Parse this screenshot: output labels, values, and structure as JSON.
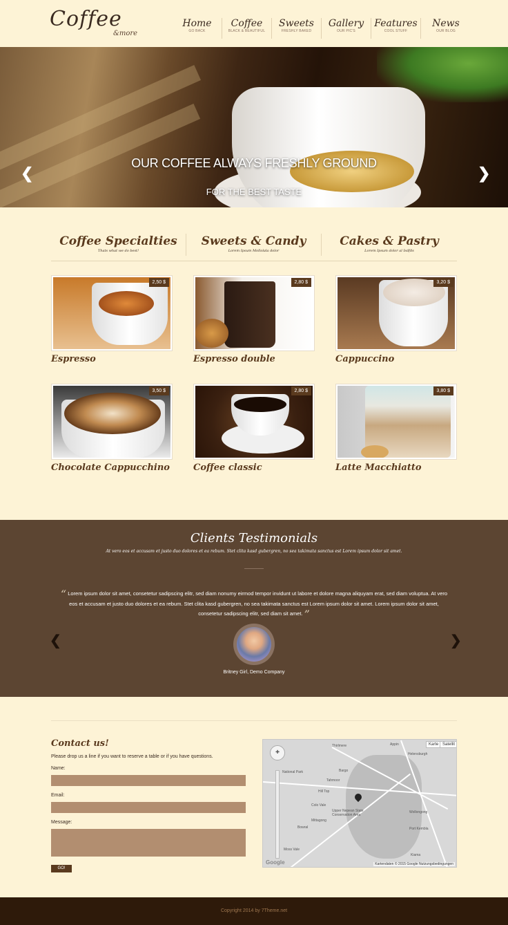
{
  "logo": {
    "main": "Coffee",
    "sub": "&more"
  },
  "nav": [
    {
      "title": "Home",
      "sub": "GO BACK"
    },
    {
      "title": "Coffee",
      "sub": "BLACK & BEAUTIFUL"
    },
    {
      "title": "Sweets",
      "sub": "FRESHLY BAKED"
    },
    {
      "title": "Gallery",
      "sub": "OUR PIC'S"
    },
    {
      "title": "Features",
      "sub": "COOL STUFF"
    },
    {
      "title": "News",
      "sub": "OUR BLOG"
    }
  ],
  "hero": {
    "title": "OUR COFFEE ALWAYS FRESHLY GROUND",
    "subtitle": "FOR THE BEST TASTE",
    "prev_icon": "chevron-left",
    "next_icon": "chevron-right"
  },
  "categories": [
    {
      "title": "Coffee Specialties",
      "sub": "Thats what we do best!"
    },
    {
      "title": "Sweets & Candy",
      "sub": "Lorem Ipsum Mollolala dolor"
    },
    {
      "title": "Cakes & Pastry",
      "sub": "Lorem Ipsum dolor al Isdfds"
    }
  ],
  "products": [
    {
      "name": "Espresso",
      "price": "2,50 $"
    },
    {
      "name": "Espresso double",
      "price": "2,80 $"
    },
    {
      "name": "Cappuccino",
      "price": "3,20 $"
    },
    {
      "name": "Chocolate Cappucchino",
      "price": "3,50 $"
    },
    {
      "name": "Coffee classic",
      "price": "2,80 $"
    },
    {
      "name": "Latte Macchiatto",
      "price": "3,80 $"
    }
  ],
  "testimonials": {
    "title": "Clients Testimonials",
    "subtitle": "At vero eos et accusam et justo duo dolores et ea rebum. Stet clita kasd gubergren, no sea takimata sanctus est Lorem ipsum dolor sit amet.",
    "quote": "Lorem ipsum dolor sit amet, consetetur sadipscing elitr, sed diam nonumy eirmod tempor invidunt ut labore et dolore magna aliquyam erat, sed diam voluptua. At vero eos et accusam et justo duo dolores et ea rebum. Stet clita kasd gubergren, no sea takimata sanctus est Lorem ipsum dolor sit amet. Lorem ipsum dolor sit amet, consetetur sadipscing elitr, sed diam sit amet.",
    "author": "Britney Girl, Demo Company",
    "prev_icon": "chevron-left",
    "next_icon": "chevron-right"
  },
  "contact": {
    "title": "Contact us!",
    "intro": "Please drop us a line if you want to reserve a table or if you have questions.",
    "name_label": "Name:",
    "email_label": "Email:",
    "message_label": "Message:",
    "submit": "GO!"
  },
  "map": {
    "map_btn": "Karte",
    "sat_btn": "Satellit",
    "attribution": "Kartendaten © 2015 Google   Nutzungsbedingungen",
    "google": "Google",
    "labels": [
      "Thirlmere",
      "Appin",
      "Helensburgh",
      "National Park",
      "Bargo",
      "Tahmoor",
      "Hill Top",
      "Colo Vale",
      "Mittagong",
      "Bowral",
      "Moss Vale",
      "Wollongong",
      "Port Kembla",
      "Upper Nepean State Conservation Area",
      "Kiama"
    ]
  },
  "footer": {
    "text": "Copyright 2014 by 7Theme.net"
  }
}
